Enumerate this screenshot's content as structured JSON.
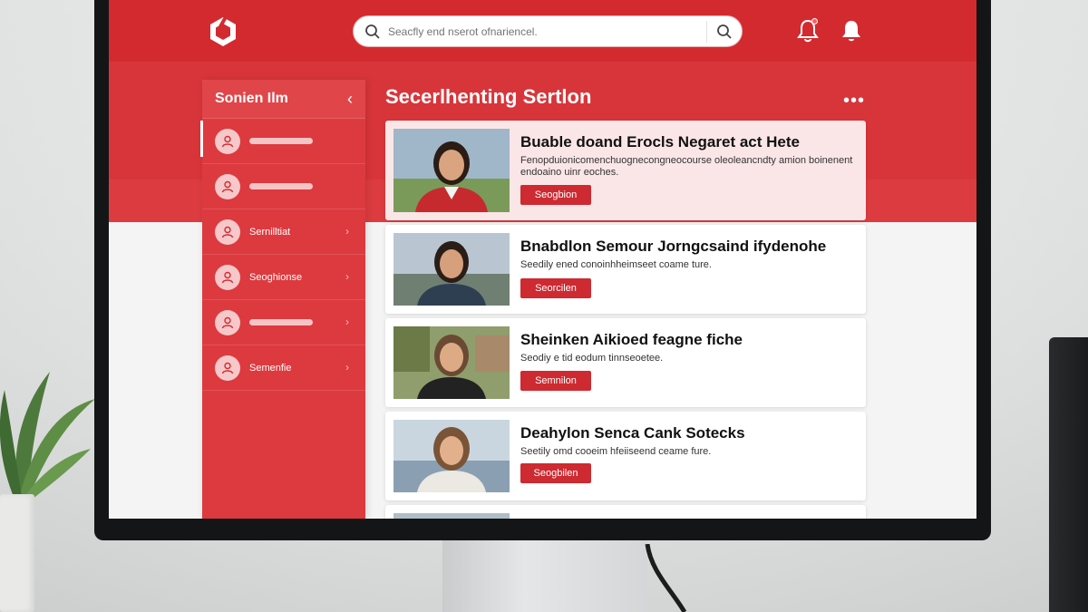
{
  "app": {
    "search": {
      "placeholder": "Seacfly end nserot ofnariencel."
    },
    "colors": {
      "primary": "#d32a30",
      "accent": "#cd2a31",
      "sidebar": "#dc3a3f",
      "highlight_card": "#fbe6e7"
    },
    "icons": {
      "logo": "hexagon-logo-icon",
      "search": "search-icon",
      "notification": "bell-icon"
    }
  },
  "sidebar": {
    "title": "Sonien Ilm",
    "items": [
      {
        "type": "bar",
        "label": ""
      },
      {
        "type": "bar",
        "label": ""
      },
      {
        "type": "text",
        "label": "Sernilltiat"
      },
      {
        "type": "text",
        "label": "Seoghionse"
      },
      {
        "type": "bar",
        "label": ""
      },
      {
        "type": "text",
        "label": "Semenfie"
      }
    ]
  },
  "main": {
    "section_title": "Secerlhenting Sertlon",
    "more": "•••",
    "cards": [
      {
        "title": "Buable doand Erocls Negaret act Hete",
        "desc": "Fenopduionicomenchuognecongneocourse oleoleancndty amion boinenent endoaino uinr eoches.",
        "button": "Seogbion"
      },
      {
        "title": "Bnabdlon Semour Jorngcsaind ifydenohe",
        "desc": "Seedily ened conoinhheimseet coame ture.",
        "button": "Seorcilen"
      },
      {
        "title": "Sheinken Aikioed feagne fiche",
        "desc": "Seodiy e tid eodum tinnseoetee.",
        "button": "Semnilon"
      },
      {
        "title": "Deahylon Senca Cank Sotecks",
        "desc": "Seetily omd cooeim hfeiiseend ceame fure.",
        "button": "Seogbilen"
      }
    ]
  }
}
